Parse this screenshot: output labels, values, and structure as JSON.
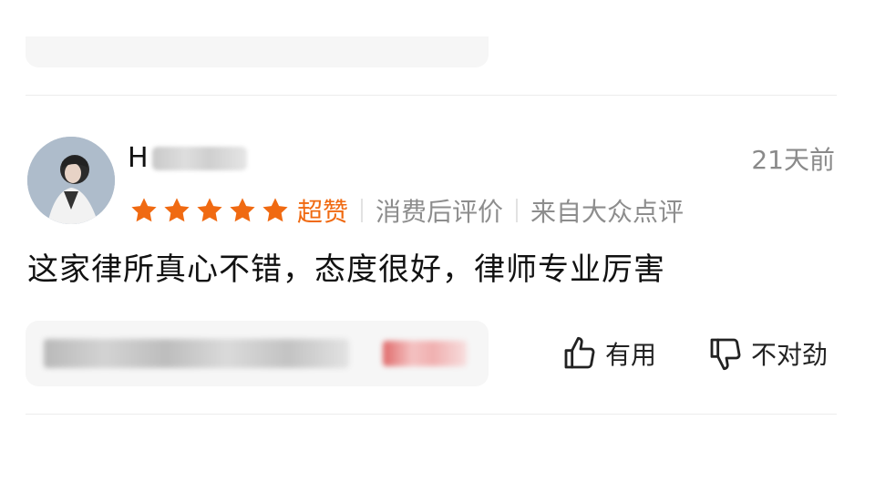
{
  "review": {
    "username_initial": "H",
    "time": "21天前",
    "stars": 5,
    "rating_text": "超赞",
    "meta_1": "消费后评价",
    "meta_2": "来自大众点评",
    "content": "这家律所真心不错，态度很好，律师专业厉害",
    "actions": {
      "useful_label": "有用",
      "not_useful_label": "不对劲"
    }
  },
  "colors": {
    "accent": "#f06a12",
    "meta_text": "#8d8d8d",
    "card_bg": "#f6f6f6"
  },
  "icons": {
    "useful": "thumbs-up-icon",
    "not_useful": "thumbs-down-icon",
    "star": "star-icon"
  }
}
